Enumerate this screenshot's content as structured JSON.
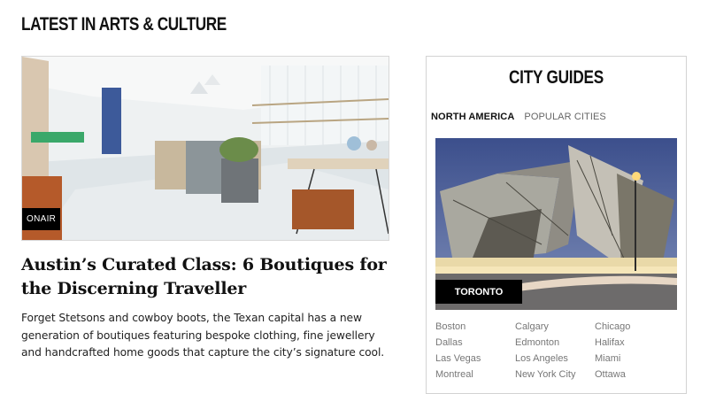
{
  "section": {
    "title": "LATEST IN ARTS & CULTURE"
  },
  "article": {
    "source_badge": "ONAIR",
    "headline": "Austin’s Curated Class: 6 Boutiques for the Discerning Traveller",
    "summary": "Forget Stetsons and cowboy boots, the Texan capital has a new generation of boutiques featuring bespoke clothing, fine jewellery and handcrafted home goods that capture the city’s signature cool."
  },
  "city_guides": {
    "title": "CITY GUIDES",
    "tabs": [
      {
        "label": "NORTH AMERICA",
        "active": true
      },
      {
        "label": "POPULAR CITIES",
        "active": false
      }
    ],
    "featured_city": "TORONTO",
    "cities": [
      "Boston",
      "Calgary",
      "Chicago",
      "Dallas",
      "Edmonton",
      "Halifax",
      "Las Vegas",
      "Los Angeles",
      "Miami",
      "Montreal",
      "New York City",
      "Ottawa"
    ]
  },
  "colors": {
    "badge_bg": "#000000",
    "link_gray": "#777777",
    "border": "#d3d3d3"
  }
}
